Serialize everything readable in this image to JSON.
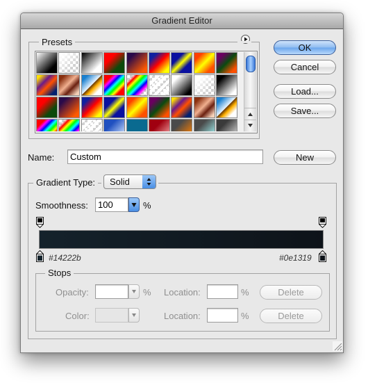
{
  "window": {
    "title": "Gradient Editor"
  },
  "presets": {
    "label": "Presets",
    "menu_icon": "play-circle-icon",
    "swatches": [
      {
        "name": "black-white",
        "bg": "linear-gradient(135deg,#ffffff,#000000 75%)"
      },
      {
        "name": "foreground-transparent",
        "bg": "checker-white"
      },
      {
        "name": "black-white-2",
        "bg": "linear-gradient(135deg,#000000,#ffffff 75%)"
      },
      {
        "name": "red-green",
        "bg": "linear-gradient(135deg,#ff0000 30%,#0b4a0b 70%)"
      },
      {
        "name": "violet-orange",
        "bg": "linear-gradient(135deg,#2a0a4a 20%,#ff5a00 85%)"
      },
      {
        "name": "blue-red-yellow",
        "bg": "linear-gradient(135deg,#1020a0 20%,#ff0000 50%,#ffff00 85%)"
      },
      {
        "name": "blue-yellow-blue",
        "bg": "linear-gradient(135deg,#0a10a0 30%,#ffff00 50%,#0a10a0 70%)"
      },
      {
        "name": "orange-yellow-orange",
        "bg": "linear-gradient(135deg,#ff4000 20%,#ffff00 50%,#ff5000 80%)"
      },
      {
        "name": "violet-green-orange",
        "bg": "linear-gradient(135deg,#6a0060 20%,#0a4a10 50%,#ff5000 85%)"
      },
      {
        "name": "yellow-violet-orange-blue",
        "bg": "linear-gradient(135deg,#ffe000 10%,#6a1a8a 35%,#ff5000 55%,#002070 85%)"
      },
      {
        "name": "copper",
        "bg": "linear-gradient(135deg,#8a3010 15%,#f0b090 45%,#6a2010 65%,#f4d0b8 90%)"
      },
      {
        "name": "chrome",
        "bg": "linear-gradient(135deg,#1a80d0 15%,#e8f4ff 48%,#6a3a00 50%,#ffb000 62%,#ffffff 80%)"
      },
      {
        "name": "spectrum",
        "bg": "linear-gradient(135deg,#ff0000 20%,#ff00ff 30%,#0000ff 40%,#00ffff 50%,#00ff00 60%,#ffff00 70%,#ff0000 80%)"
      },
      {
        "name": "transparent-rainbow",
        "bg": "linear-gradient(135deg,rgba(255,255,255,0) 15%,#ff0000 25%,#ffff00 35%,#00ff00 45%,#00ffff 55%,#0000ff 65%,#ff00ff 75%,rgba(255,255,255,0) 85%)"
      },
      {
        "name": "transparent-stripes",
        "bg": "repeating-linear-gradient(135deg,#ffffff 0 4px,rgba(255,255,255,0) 4px 8px)"
      },
      {
        "name": "white-black-diag",
        "bg": "linear-gradient(135deg,#ffffff 20%,#000000 85%)"
      },
      {
        "name": "white-transparent",
        "bg": "linear-gradient(135deg,#ffffff 20%,rgba(255,255,255,0) 75%)"
      },
      {
        "name": "black-white-diag",
        "bg": "linear-gradient(135deg,#000000 20%,#ffffff 85%)"
      },
      {
        "name": "red-green-2",
        "bg": "linear-gradient(135deg,#ff0000 30%,#0b4a0b 70%)"
      },
      {
        "name": "violet-orange-2",
        "bg": "linear-gradient(135deg,#2a0a4a 20%,#ff5a00 85%)"
      },
      {
        "name": "blue-red-yellow-2",
        "bg": "linear-gradient(135deg,#1020a0 20%,#ff0000 50%,#ffff00 85%)"
      },
      {
        "name": "blue-yellow-blue-2",
        "bg": "linear-gradient(135deg,#0a10a0 30%,#ffff00 50%,#0a10a0 70%)"
      },
      {
        "name": "orange-yellow-orange-2",
        "bg": "linear-gradient(135deg,#ff4000 20%,#ffff00 50%,#ff5000 80%)"
      },
      {
        "name": "violet-green-orange-2",
        "bg": "linear-gradient(135deg,#6a0060 20%,#0a4a10 50%,#ff5000 85%)"
      },
      {
        "name": "yellow-violet-orange-blue-2",
        "bg": "linear-gradient(135deg,#ffe000 10%,#6a1a8a 35%,#ff5000 55%,#002070 85%)"
      },
      {
        "name": "copper-2",
        "bg": "linear-gradient(135deg,#8a3010 15%,#f0b090 45%,#6a2010 65%,#f4d0b8 90%)"
      },
      {
        "name": "chrome-2",
        "bg": "linear-gradient(135deg,#1a80d0 15%,#e8f4ff 48%,#6a3a00 50%,#ffb000 62%,#ffffff 80%)"
      },
      {
        "name": "spectrum-2",
        "bg": "linear-gradient(135deg,#ff0000 20%,#ff00ff 30%,#0000ff 40%,#00ffff 50%,#00ff00 60%,#ffff00 70%,#ff0000 80%)"
      },
      {
        "name": "transparent-rainbow-2",
        "bg": "linear-gradient(135deg,rgba(255,255,255,0) 15%,#ff0000 25%,#ffff00 35%,#00ff00 45%,#00ffff 55%,#0000ff 65%,#ff00ff 75%,rgba(255,255,255,0) 85%)"
      },
      {
        "name": "transparent-stripes-2",
        "bg": "repeating-linear-gradient(135deg,#ffffff 0 4px,rgba(255,255,255,0) 4px 8px)"
      },
      {
        "name": "blue-light",
        "bg": "linear-gradient(135deg,#2050c0 30%,#d0e4ff 90%)"
      },
      {
        "name": "teal",
        "bg": "linear-gradient(135deg,#0a6a90,#0a6a90)"
      },
      {
        "name": "red-pink",
        "bg": "linear-gradient(135deg,#a00010 35%,#f0a0a0 90%)"
      },
      {
        "name": "gray-orange",
        "bg": "linear-gradient(135deg,#4a4a4a 30%,#ff8000 90%)"
      },
      {
        "name": "gray-cyan",
        "bg": "linear-gradient(135deg,#4a4a4a 30%,#a0f0f0 90%)"
      },
      {
        "name": "gray-white",
        "bg": "linear-gradient(135deg,#3a3a3a 30%,#e0e0e0 95%)"
      }
    ]
  },
  "buttons": {
    "ok": "OK",
    "cancel": "Cancel",
    "load": "Load...",
    "save": "Save...",
    "new": "New"
  },
  "name_field": {
    "label": "Name:",
    "value": "Custom"
  },
  "gradient_type": {
    "label": "Gradient Type:",
    "value": "Solid"
  },
  "smoothness": {
    "label": "Smoothness:",
    "value": "100",
    "unit": "%"
  },
  "gradient": {
    "start_color": "#14222b",
    "end_color": "#0e1319",
    "start_label": "#14222b",
    "end_label": "#0e1319",
    "opacity_stops": [
      {
        "location_pct": 0
      },
      {
        "location_pct": 100
      }
    ],
    "color_stops": [
      {
        "location_pct": 0,
        "color": "#14222b"
      },
      {
        "location_pct": 100,
        "color": "#0e1319"
      }
    ]
  },
  "stops": {
    "label": "Stops",
    "opacity_label": "Opacity:",
    "opacity_value": "",
    "opacity_unit": "%",
    "opacity_location_label": "Location:",
    "opacity_location_value": "",
    "opacity_location_unit": "%",
    "opacity_delete": "Delete",
    "color_label": "Color:",
    "color_location_label": "Location:",
    "color_location_value": "",
    "color_location_unit": "%",
    "color_delete": "Delete"
  }
}
